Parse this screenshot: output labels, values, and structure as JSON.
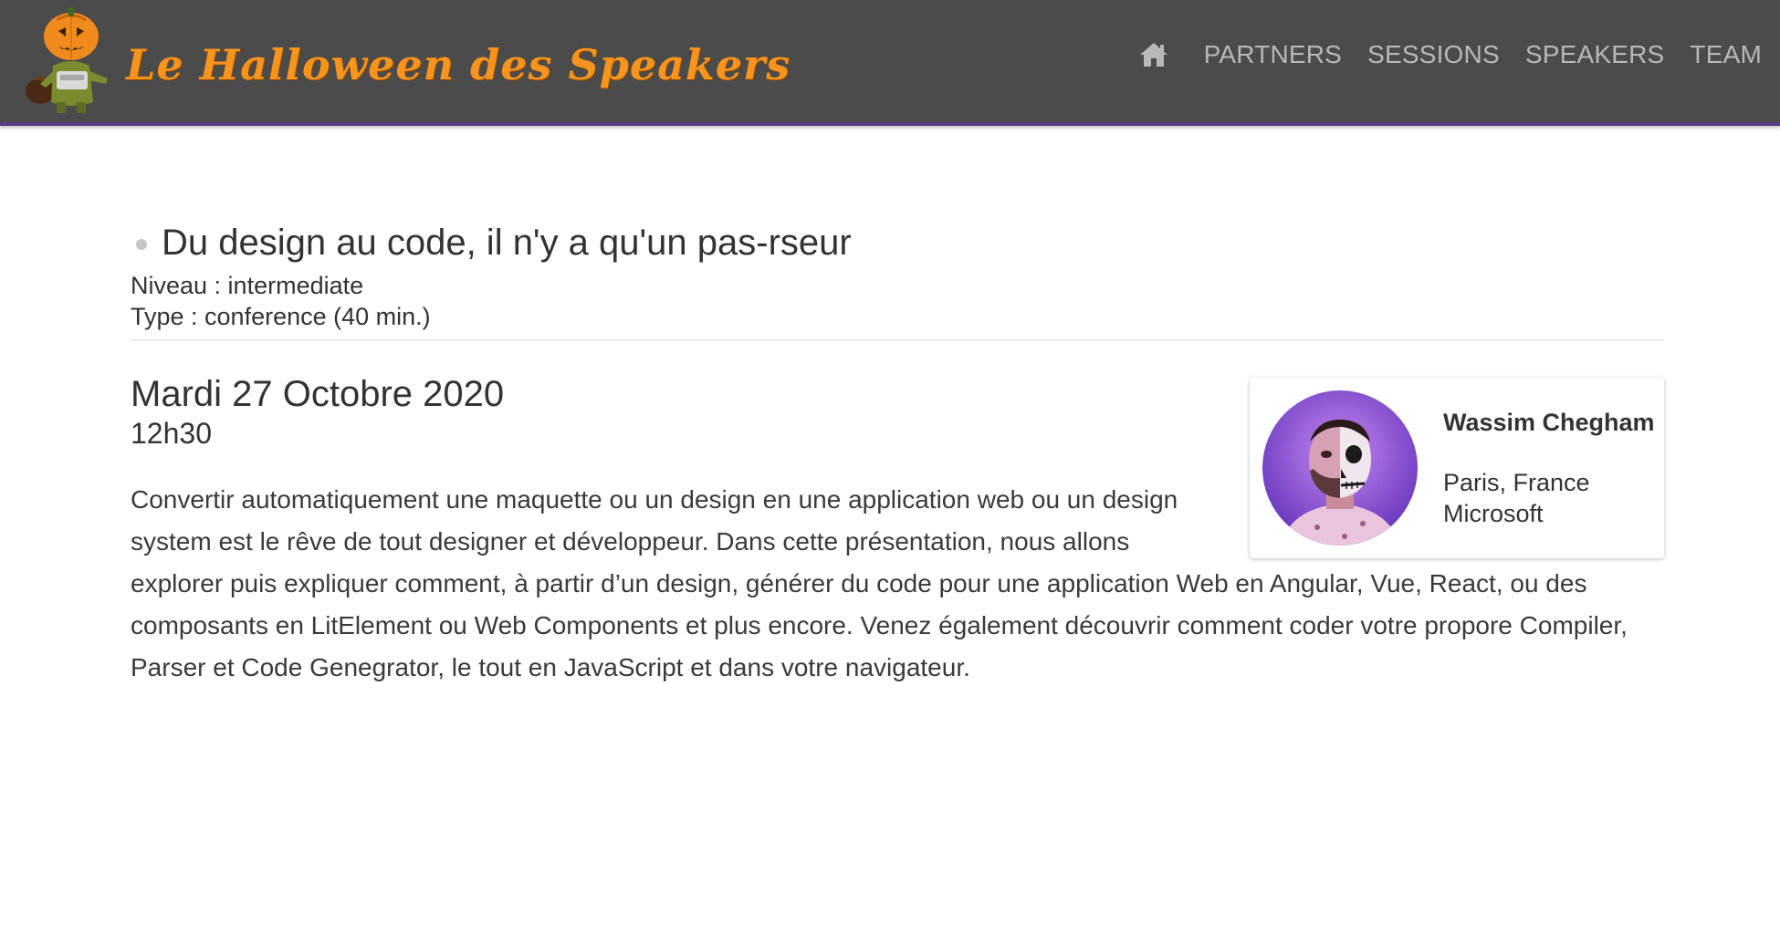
{
  "header": {
    "logo_text": "Le Halloween des Speakers",
    "logo_icon": "pumpkin-mascot-icon",
    "home_icon": "home-icon",
    "nav": [
      "PARTNERS",
      "SESSIONS",
      "SPEAKERS",
      "TEAM"
    ]
  },
  "session": {
    "title": "Du design au code, il n'y a qu'un pas-rseur",
    "level_line": "Niveau : intermediate",
    "type_line": "Type : conference (40 min.)",
    "date": "Mardi 27 Octobre 2020",
    "time": "12h30",
    "description": "Convertir automatiquement une maquette ou un design en une application web ou un design system est le rêve de tout designer et développeur. Dans cette présentation, nous allons explorer puis expliquer comment, à partir d’un design, générer du code pour une application Web en Angular, Vue, React, ou des composants en LitElement ou Web Components et plus encore. Venez également découvrir comment coder votre propore Compiler, Parser et Code Genegrator, le tout en JavaScript et dans votre navigateur."
  },
  "speaker": {
    "name": "Wassim Chegham",
    "location": "Paris, France",
    "company": "Microsoft"
  },
  "colors": {
    "header_bg": "#4b4b4b",
    "header_border": "#5a3d8a",
    "logo_orange": "#f7941d",
    "nav_text": "#b8b8b8"
  }
}
